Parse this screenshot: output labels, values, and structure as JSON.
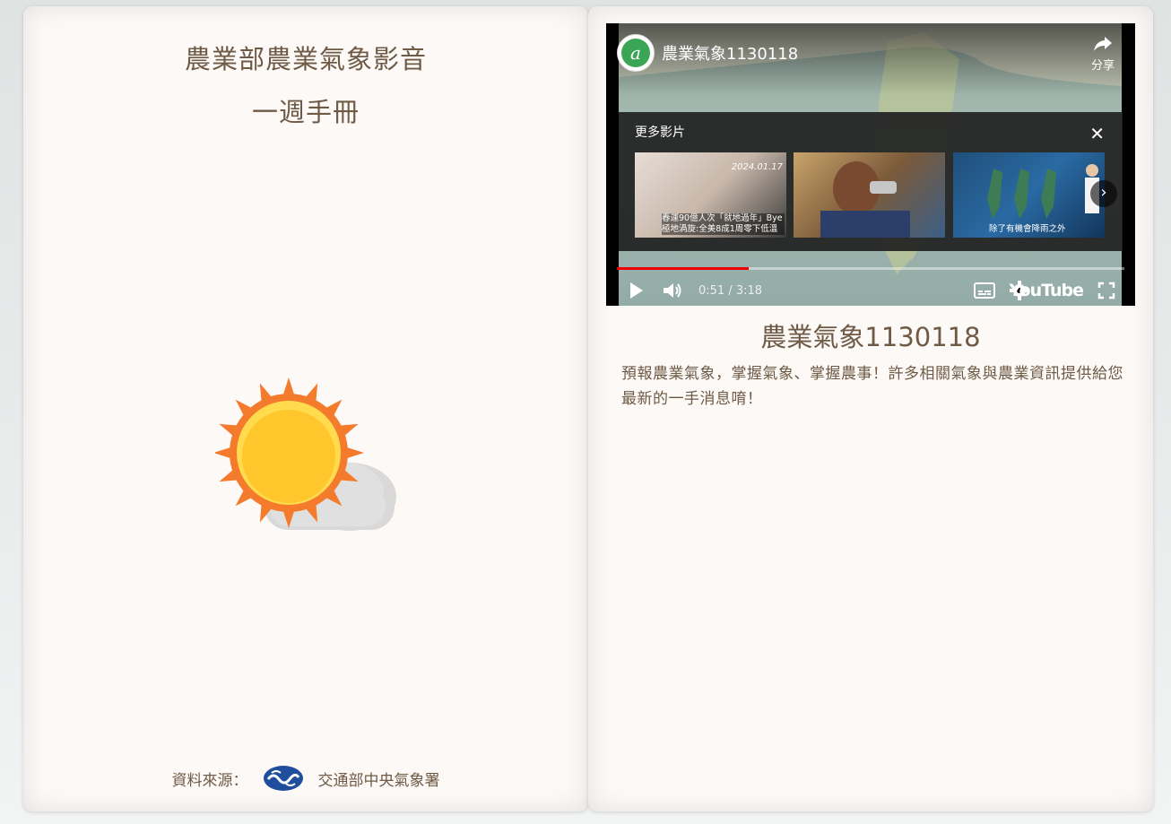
{
  "left_page": {
    "title_line1": "農業部農業氣象影音",
    "title_line2": "一週手冊",
    "weather_icon": "sun-behind-cloud-icon",
    "source_label": "資料來源：",
    "source_org": "交通部中央氣象署"
  },
  "video": {
    "title": "農業氣象1130118",
    "share_label": "分享",
    "more_videos_label": "更多影片",
    "thumbnails": [
      {
        "tag": "2024.01.17",
        "caption": "春運90億人次「就地過年」Bye 極地渦旋:全美8成1周零下低溫"
      },
      {
        "tag": "",
        "caption": ""
      },
      {
        "tag": "",
        "caption": "除了有機會降雨之外"
      }
    ],
    "current_time": "0:51",
    "duration": "3:18",
    "time_display": "0:51 / 3:18",
    "progress": 0.26,
    "platform": "YouTube"
  },
  "article": {
    "title": "農業氣象1130118",
    "description": "預報農業氣象，掌握氣象、掌握農事！許多相關氣象與農業資訊提供給您最新的一手消息唷！"
  },
  "colors": {
    "text": "#6e5a45",
    "page_bg": "#fdf9f7",
    "sun": "#ffc72c",
    "sun_rays": "#f47a2c",
    "progress": "#ee0000"
  }
}
